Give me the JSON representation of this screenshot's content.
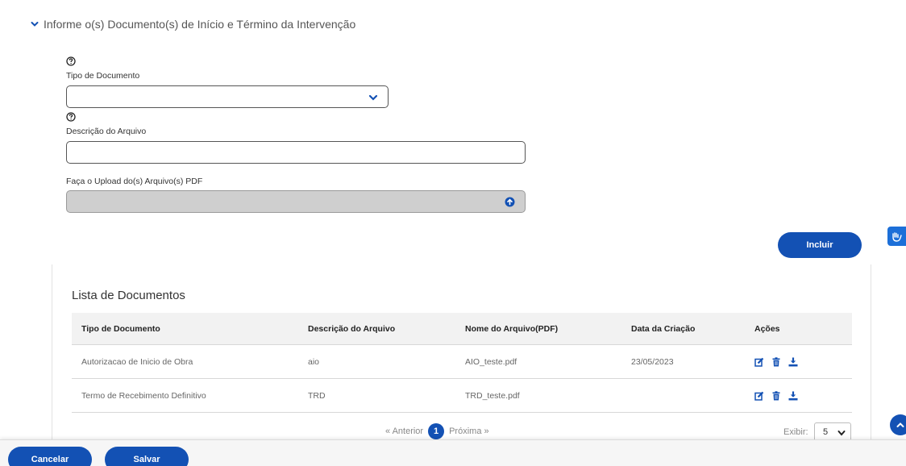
{
  "section": {
    "title": "Informe o(s) Documento(s) de Início e Término da Intervenção"
  },
  "form": {
    "tipo_label": "Tipo de Documento",
    "tipo_value": "",
    "descricao_label": "Descrição do Arquivo",
    "descricao_value": "",
    "upload_label": "Faça o Upload do(s) Arquivo(s) PDF",
    "incluir_label": "Incluir"
  },
  "list": {
    "title": "Lista de Documentos",
    "headers": [
      "Tipo de Documento",
      "Descrição do Arquivo",
      "Nome do Arquivo(PDF)",
      "Data da Criação",
      "Ações"
    ],
    "rows": [
      {
        "tipo": "Autorizacao de Inicio de Obra",
        "descricao": "aio",
        "nome": "AIO_teste.pdf",
        "data": "23/05/2023"
      },
      {
        "tipo": "Termo de Recebimento Definitivo",
        "descricao": "TRD",
        "nome": "TRD_teste.pdf",
        "data": ""
      }
    ]
  },
  "pagination": {
    "prev": "« Anterior",
    "current": "1",
    "next": "Próxima »",
    "exibir_label": "Exibir:",
    "exibir_value": "5"
  },
  "footer": {
    "cancelar": "Cancelar",
    "salvar": "Salvar"
  },
  "colors": {
    "primary": "#1351b4",
    "header_bg": "#f2f2f2"
  },
  "icons": [
    "chevron-down-icon",
    "help-icon",
    "upload-icon",
    "edit-icon",
    "trash-icon",
    "download-icon",
    "sign-language-icon",
    "arrow-up-icon"
  ]
}
